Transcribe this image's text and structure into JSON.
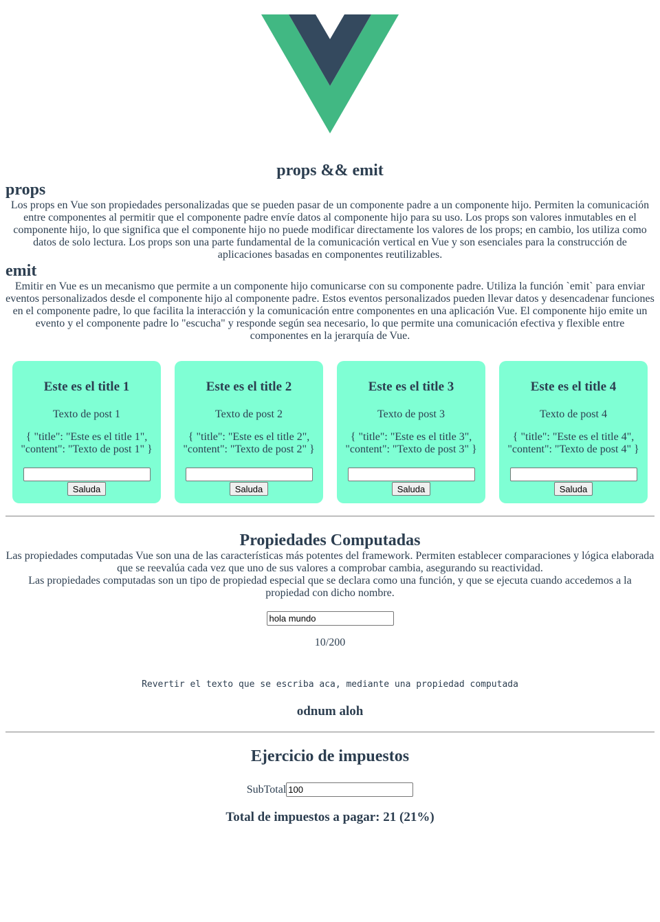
{
  "logo": {
    "name": "vue-logo",
    "colors": {
      "outer": "#41b883",
      "inner": "#34495e"
    }
  },
  "main_title": "props && emit",
  "props_section": {
    "heading": "props",
    "text": "Los props en Vue son propiedades personalizadas que se pueden pasar de un componente padre a un componente hijo. Permiten la comunicación entre componentes al permitir que el componente padre envíe datos al componente hijo para su uso. Los props son valores inmutables en el componente hijo, lo que significa que el componente hijo no puede modificar directamente los valores de los props; en cambio, los utiliza como datos de solo lectura. Los props son una parte fundamental de la comunicación vertical en Vue y son esenciales para la construcción de aplicaciones basadas en componentes reutilizables."
  },
  "emit_section": {
    "heading": "emit",
    "text": "Emitir en Vue es un mecanismo que permite a un componente hijo comunicarse con su componente padre. Utiliza la función `emit` para enviar eventos personalizados desde el componente hijo al componente padre. Estos eventos personalizados pueden llevar datos y desencadenar funciones en el componente padre, lo que facilita la interacción y la comunicación entre componentes en una aplicación Vue. El componente hijo emite un evento y el componente padre lo \"escucha\" y responde según sea necesario, lo que permite una comunicación efectiva y flexible entre componentes en la jerarquía de Vue."
  },
  "cards": [
    {
      "title": "Este es el title 1",
      "content": "Texto de post 1",
      "json": "{ \"title\": \"Este es el title 1\", \"content\": \"Texto de post 1\" }",
      "input_value": "",
      "button": "Saluda"
    },
    {
      "title": "Este es el title 2",
      "content": "Texto de post 2",
      "json": "{ \"title\": \"Este es el title 2\", \"content\": \"Texto de post 2\" }",
      "input_value": "",
      "button": "Saluda"
    },
    {
      "title": "Este es el title 3",
      "content": "Texto de post 3",
      "json": "{ \"title\": \"Este es el title 3\", \"content\": \"Texto de post 3\" }",
      "input_value": "",
      "button": "Saluda"
    },
    {
      "title": "Este es el title 4",
      "content": "Texto de post 4",
      "json": "{ \"title\": \"Este es el title 4\", \"content\": \"Texto de post 4\" }",
      "input_value": "",
      "button": "Saluda"
    }
  ],
  "card_color": "#7fffd4",
  "computed": {
    "heading": "Propiedades Computadas",
    "p1": "Las propiedades computadas Vue son una de las características más potentes del framework. Permiten establecer comparaciones y lógica elaborada que se reevalúa cada vez que uno de sus valores a comprobar cambia, asegurando su reactividad.",
    "p2": "Las propiedades computadas son un tipo de propiedad especial que se declara como una función, y que se ejecuta cuando accedemos a la propiedad con dicho nombre.",
    "input_value": "hola mundo",
    "counter": "10/200",
    "note": "Revertir el texto que se escriba aca, mediante una propiedad computada",
    "reversed": "odnum aloh"
  },
  "taxes": {
    "heading": "Ejercicio de impuestos",
    "label": "SubTotal",
    "input_value": "100",
    "total": "Total de impuestos a pagar: 21 (21%)"
  }
}
